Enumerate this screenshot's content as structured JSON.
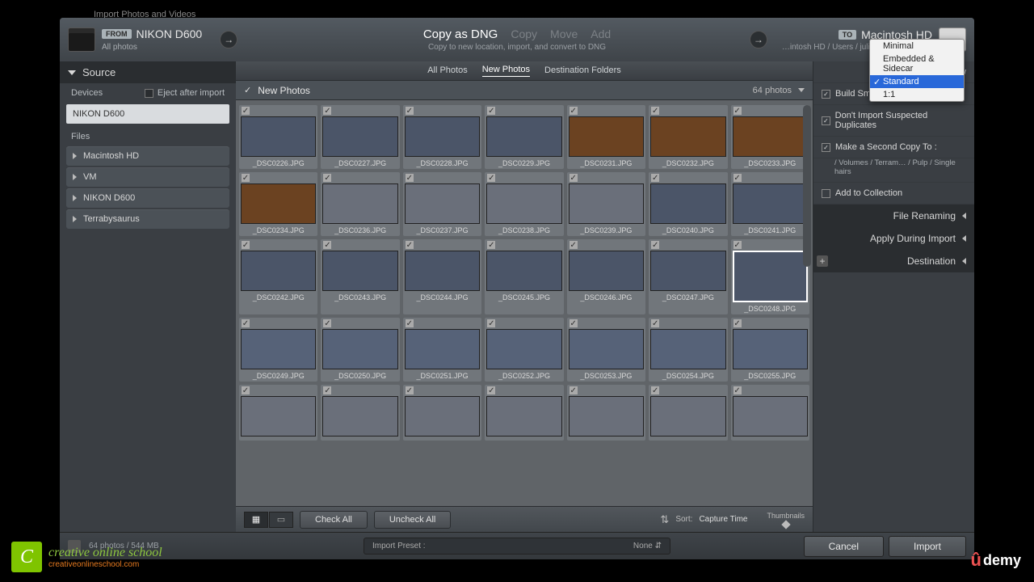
{
  "window_title": "Import Photos and Videos",
  "header": {
    "from_badge": "FROM",
    "from_device": "NIKON D600",
    "from_sub": "All photos",
    "modes": {
      "copy_dng": "Copy as DNG",
      "copy": "Copy",
      "move": "Move",
      "add": "Add"
    },
    "mode_desc": "Copy to new location, import, and convert to DNG",
    "to_badge": "TO",
    "to_device": "Macintosh HD",
    "to_path": "…intosh HD / Users / juliasquire / Pictures"
  },
  "left": {
    "source": "Source",
    "devices": "Devices",
    "eject": "Eject after import",
    "selected": "NIKON D600",
    "files": "Files",
    "nodes": [
      "Macintosh HD",
      "VM",
      "NIKON D600",
      "Terrabysaurus"
    ]
  },
  "tabs": {
    "all": "All Photos",
    "new": "New Photos",
    "dest": "Destination Folders"
  },
  "subbar": {
    "title": "New Photos",
    "count": "64 photos"
  },
  "thumbs": [
    {
      "n": "_DSC0226.JPG",
      "c": "street"
    },
    {
      "n": "_DSC0227.JPG",
      "c": "street"
    },
    {
      "n": "_DSC0228.JPG",
      "c": "street"
    },
    {
      "n": "_DSC0229.JPG",
      "c": "street"
    },
    {
      "n": "_DSC0231.JPG",
      "c": "food"
    },
    {
      "n": "_DSC0232.JPG",
      "c": "food"
    },
    {
      "n": "_DSC0233.JPG",
      "c": "food"
    },
    {
      "n": "_DSC0234.JPG",
      "c": "food"
    },
    {
      "n": "_DSC0236.JPG",
      "c": "bldg"
    },
    {
      "n": "_DSC0237.JPG",
      "c": "bldg"
    },
    {
      "n": "_DSC0238.JPG",
      "c": "bldg"
    },
    {
      "n": "_DSC0239.JPG",
      "c": "bldg"
    },
    {
      "n": "_DSC0240.JPG",
      "c": "street"
    },
    {
      "n": "_DSC0241.JPG",
      "c": "street"
    },
    {
      "n": "_DSC0242.JPG",
      "c": "street"
    },
    {
      "n": "_DSC0243.JPG",
      "c": "street"
    },
    {
      "n": "_DSC0244.JPG",
      "c": "street"
    },
    {
      "n": "_DSC0245.JPG",
      "c": "street"
    },
    {
      "n": "_DSC0246.JPG",
      "c": "street"
    },
    {
      "n": "_DSC0247.JPG",
      "c": "street"
    },
    {
      "n": "_DSC0248.JPG",
      "c": "street",
      "sel": true
    },
    {
      "n": "_DSC0249.JPG",
      "c": "square"
    },
    {
      "n": "_DSC0250.JPG",
      "c": "square"
    },
    {
      "n": "_DSC0251.JPG",
      "c": "square"
    },
    {
      "n": "_DSC0252.JPG",
      "c": "square"
    },
    {
      "n": "_DSC0253.JPG",
      "c": "square"
    },
    {
      "n": "_DSC0254.JPG",
      "c": "square"
    },
    {
      "n": "_DSC0255.JPG",
      "c": "square"
    },
    {
      "n": "",
      "c": "bldg"
    },
    {
      "n": "",
      "c": "bldg"
    },
    {
      "n": "",
      "c": "bldg"
    },
    {
      "n": "",
      "c": "bldg"
    },
    {
      "n": "",
      "c": "bldg"
    },
    {
      "n": "",
      "c": "bldg"
    },
    {
      "n": "",
      "c": "bldg"
    }
  ],
  "toolbar": {
    "check_all": "Check All",
    "uncheck_all": "Uncheck All",
    "sort_lbl": "Sort:",
    "sort_val": "Capture Time",
    "thumbs": "Thumbnails"
  },
  "right": {
    "build_previews": "Build Preview",
    "dropdown": [
      "Minimal",
      "Embedded & Sidecar",
      "Standard",
      "1:1"
    ],
    "smart": "Build Smart Previews",
    "dup": "Don't Import Suspected Duplicates",
    "second": "Make a Second Copy To :",
    "second_path": "/ Volumes / Terram… / Pulp / Single hairs",
    "collection": "Add to Collection",
    "sections": [
      "File Renaming",
      "Apply During Import",
      "Destination"
    ]
  },
  "footer": {
    "info": "64 photos / 544 MB",
    "preset_lbl": "Import Preset :",
    "preset_val": "None",
    "cancel": "Cancel",
    "import": "Import"
  },
  "brand": {
    "letter": "C",
    "name": "creative online school",
    "url": "creativeonlineschool.com"
  },
  "udemy": "demy"
}
